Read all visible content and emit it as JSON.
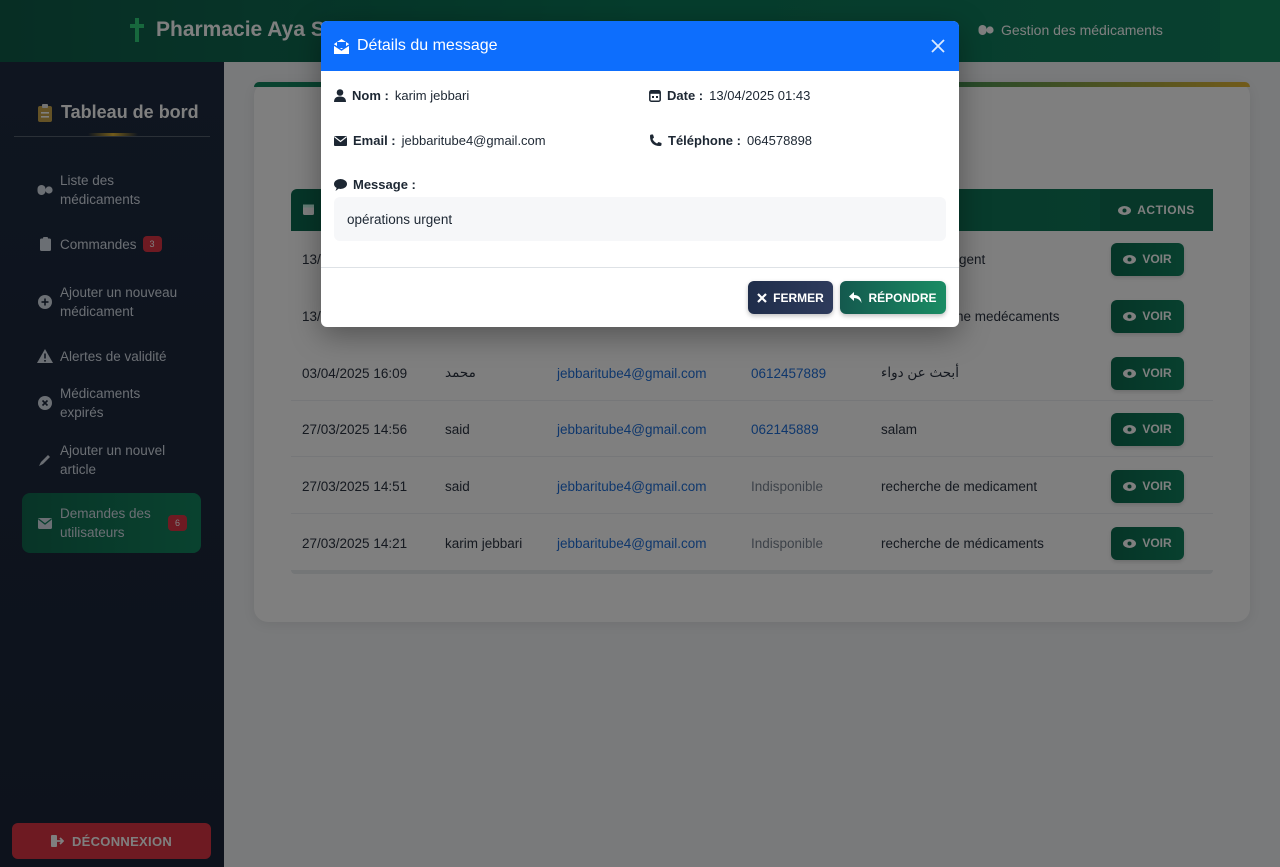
{
  "navbar": {
    "brand": "Pharmacie Aya S",
    "link_medicaments": "Gestion des médicaments"
  },
  "sidebar": {
    "title": "Tableau de bord",
    "items": [
      {
        "label": "Liste des médicaments",
        "icon": "pills-icon"
      },
      {
        "label": "Commandes",
        "icon": "clipboard-icon",
        "badge": "3"
      },
      {
        "label": "Ajouter un nouveau médicament",
        "icon": "plus-circle-icon"
      },
      {
        "label": "Alertes de validité",
        "icon": "warning-icon"
      },
      {
        "label": "Médicaments expirés",
        "icon": "x-circle-icon"
      },
      {
        "label": "Ajouter un nouvel article",
        "icon": "pen-icon"
      },
      {
        "label": "Demandes des utilisateurs",
        "icon": "envelope-icon",
        "badge": "6",
        "active": true
      }
    ],
    "logout": "DÉCONNEXION"
  },
  "table": {
    "actions_header": "ACTIONS",
    "clipped_rows": [
      {
        "date": "13/",
        "msg_fragment": "gent"
      },
      {
        "date": "13/",
        "msg_fragment": "ne medécaments"
      }
    ],
    "rows": [
      {
        "date": "03/04/2025 16:09",
        "name": "محمد",
        "email": "jebbaritube4@gmail.com",
        "phone": "0612457889",
        "message": "أبحث عن دواء"
      },
      {
        "date": "27/03/2025 14:56",
        "name": "said",
        "email": "jebbaritube4@gmail.com",
        "phone": "062145889",
        "message": "salam"
      },
      {
        "date": "27/03/2025 14:51",
        "name": "said",
        "email": "jebbaritube4@gmail.com",
        "phone": "Indisponible",
        "message": "recherche de medicament"
      },
      {
        "date": "27/03/2025 14:21",
        "name": "karim jebbari",
        "email": "jebbaritube4@gmail.com",
        "phone": "Indisponible",
        "message": "recherche de médicaments"
      }
    ],
    "voir_label": "VOIR"
  },
  "modal": {
    "title": "Détails du message",
    "nom_label": "Nom :",
    "nom_value": "karim jebbari",
    "date_label": "Date :",
    "date_value": "13/04/2025 01:43",
    "email_label": "Email :",
    "email_value": "jebbaritube4@gmail.com",
    "tel_label": "Téléphone :",
    "tel_value": "064578898",
    "message_label": "Message :",
    "message_value": "opérations urgent",
    "fermer": "FERMER",
    "repondre": "RÉPONDRE"
  },
  "colors": {
    "brand_green": "#0c7a5a",
    "modal_blue": "#0d6efd",
    "badge_red": "#dc3545",
    "link_blue": "#1e6fd9"
  }
}
